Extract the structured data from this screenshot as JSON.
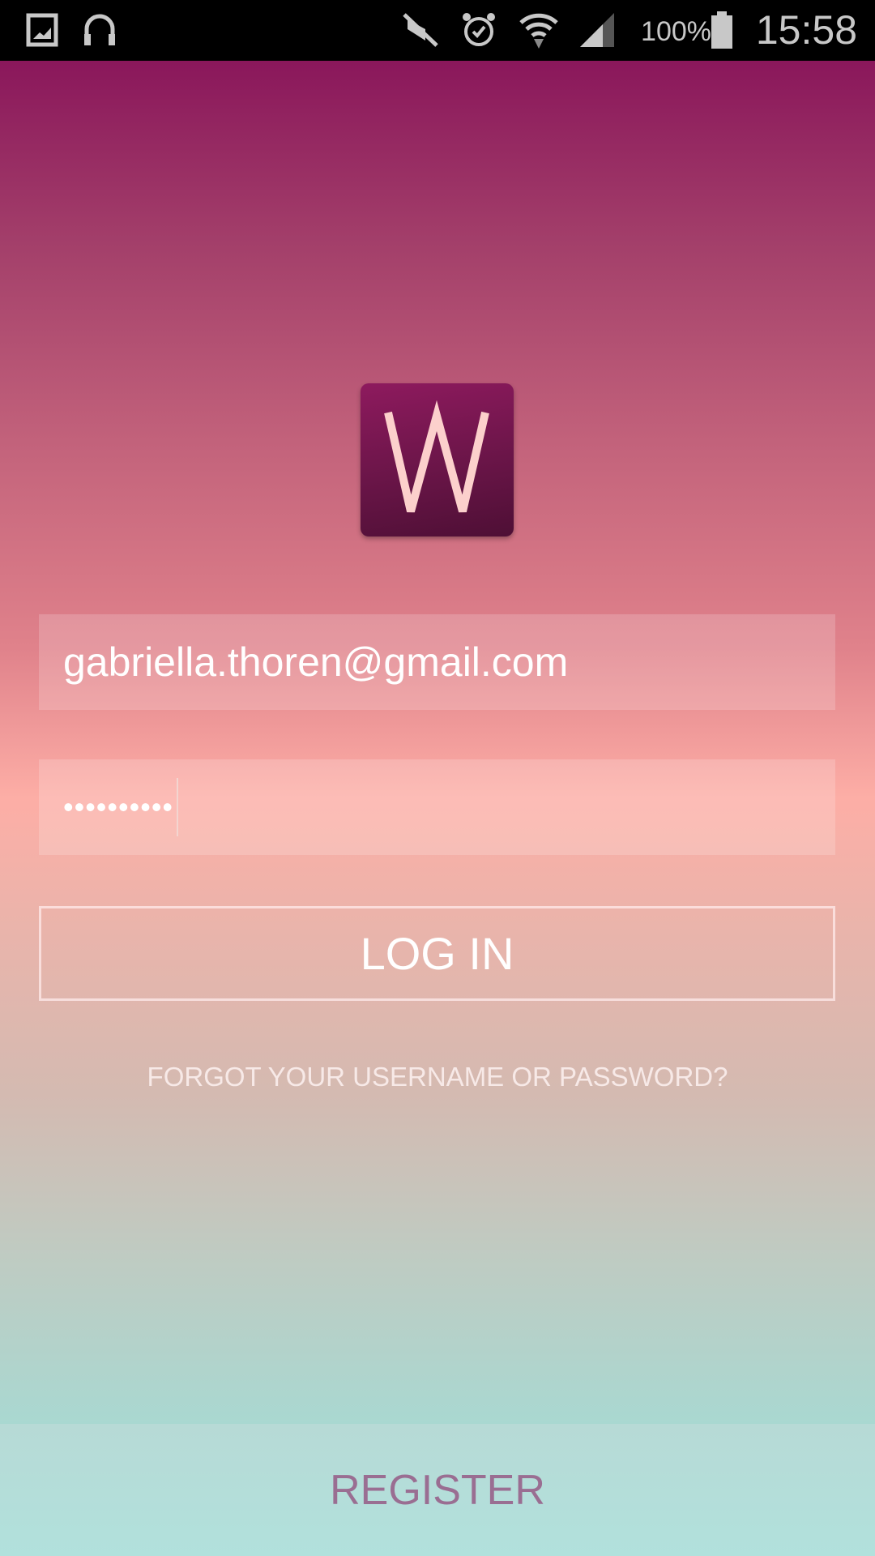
{
  "status_bar": {
    "battery": "100%",
    "time": "15:58",
    "icons": [
      "gallery-icon",
      "headphones-icon",
      "mute-icon",
      "alarm-icon",
      "wifi-icon",
      "signal-icon",
      "battery-icon"
    ]
  },
  "app": {
    "logo_letter": "W"
  },
  "login_form": {
    "email_value": "gabriella.thoren@gmail.com",
    "password_value": "••••••••••",
    "login_label": "LOG IN",
    "forgot_label": "FORGOT YOUR USERNAME OR PASSWORD?"
  },
  "footer": {
    "register_label": "REGISTER"
  }
}
